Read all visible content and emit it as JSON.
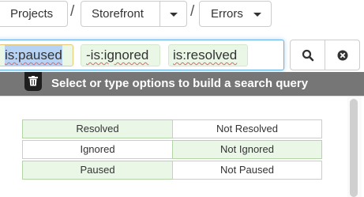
{
  "breadcrumb": {
    "projects_label": "Projects",
    "separator": "/",
    "project_label": "Storefront",
    "view_label": "Errors"
  },
  "search": {
    "tokens": [
      "is:paused",
      "-is:ignored",
      "is:resolved"
    ],
    "search_icon": "search-icon",
    "clear_icon": "clear-circle-icon"
  },
  "hint": {
    "text": "Select or type options to build a search query",
    "trash_icon": "trash-icon"
  },
  "options": {
    "rows": [
      {
        "left": "Resolved",
        "right": "Not Resolved",
        "selected": "left"
      },
      {
        "left": "Ignored",
        "right": "Not Ignored",
        "selected": "right"
      },
      {
        "left": "Paused",
        "right": "Not Paused",
        "selected": "left"
      }
    ]
  },
  "colors": {
    "token_bg": "#eaf7e6",
    "focus_border": "#66afe9",
    "hint_bar": "#767676"
  }
}
